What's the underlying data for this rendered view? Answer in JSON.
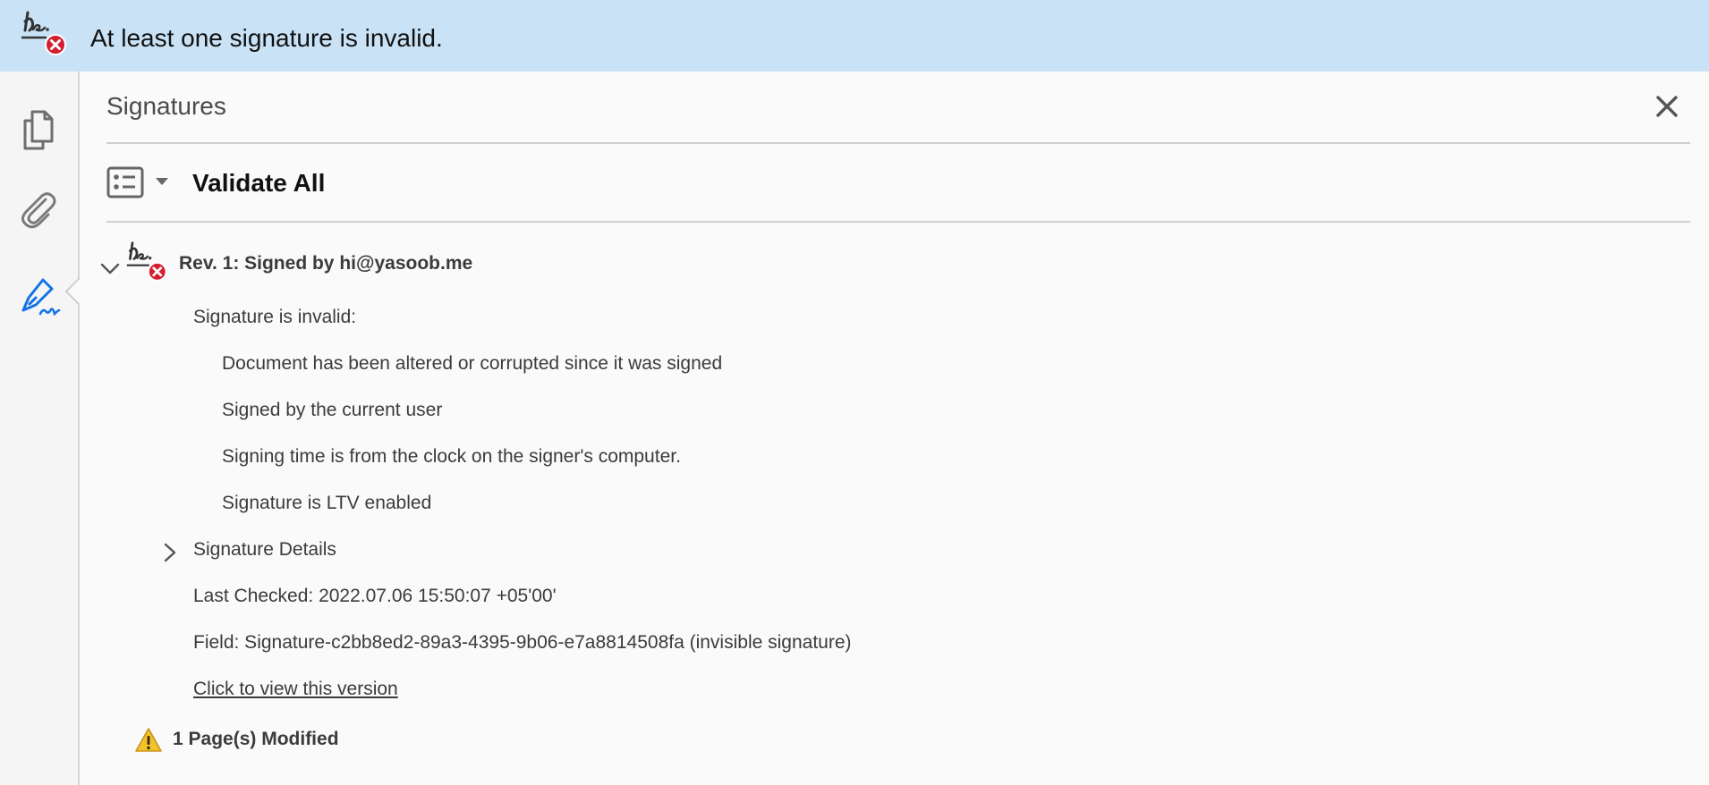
{
  "banner": {
    "icon": "invalid-signature-icon",
    "message": "At least one signature is invalid."
  },
  "rail": {
    "items": [
      {
        "icon": "page-thumbnails-icon"
      },
      {
        "icon": "paperclip-icon"
      },
      {
        "icon": "signature-pen-icon",
        "active": true
      }
    ]
  },
  "panel": {
    "title": "Signatures",
    "close_icon": "close-icon",
    "toolbar": {
      "options_icon": "list-options-icon",
      "validate_label": "Validate All"
    },
    "revision": {
      "title": "Rev. 1: Signed by hi@yasoob.me",
      "status": "Signature is invalid:",
      "reasons": [
        "Document has been altered or corrupted since it was signed",
        "Signed by the current user",
        "Signing time is from the clock on the signer's computer.",
        "Signature is LTV enabled"
      ],
      "details_label": "Signature Details",
      "last_checked": "Last Checked: 2022.07.06 15:50:07 +05'00'",
      "field": "Field: Signature-c2bb8ed2-89a3-4395-9b06-e7a8814508fa (invisible signature)",
      "view_link": "Click to view this version"
    },
    "modified_notice": "1 Page(s) Modified"
  },
  "colors": {
    "banner_bg": "#c9e2f5",
    "error_red": "#d31f30",
    "active_blue": "#1473e6",
    "warning_yellow": "#f2c12e"
  }
}
